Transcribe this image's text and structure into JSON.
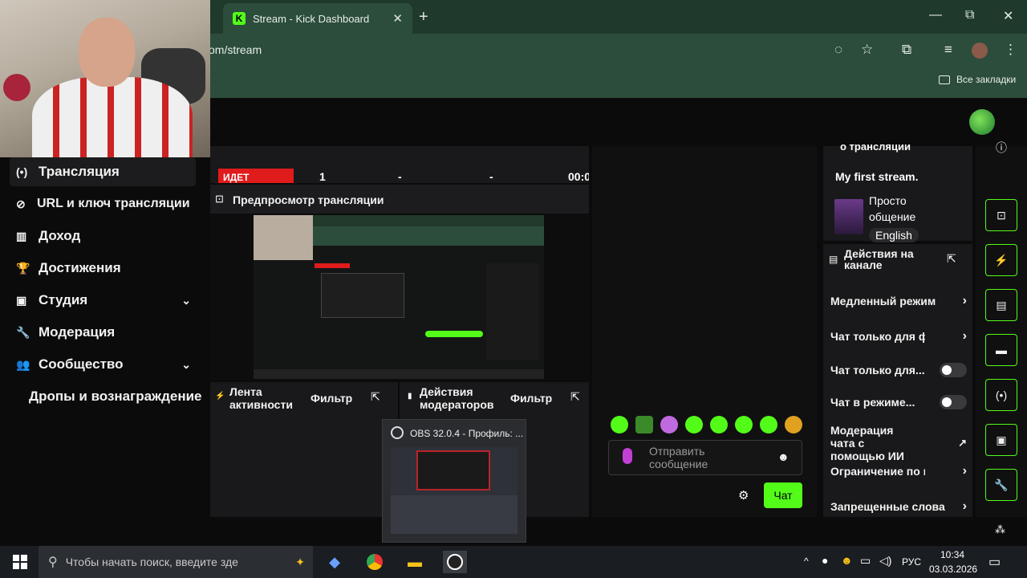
{
  "browser": {
    "tab_title": "Stream - Kick Dashboard",
    "tab_close": "✕",
    "new_tab": "+",
    "url": "om/stream",
    "bookmarks_label": "Все закладки",
    "window_controls": {
      "minimize": "—",
      "restore": "⧉",
      "close": "✕"
    }
  },
  "sidebar": {
    "items": [
      {
        "label": "Трансляция",
        "icon": "broadcast-icon",
        "glyph": "(•)"
      },
      {
        "label": "URL и ключ трансляции",
        "icon": "link-icon",
        "glyph": "⊘"
      },
      {
        "label": "Доход",
        "icon": "chart-icon",
        "glyph": "▥"
      },
      {
        "label": "Достижения",
        "icon": "trophy-icon",
        "glyph": "🏆"
      },
      {
        "label": "Студия",
        "icon": "video-icon",
        "glyph": "▣"
      },
      {
        "label": "Модерация",
        "icon": "wrench-icon",
        "glyph": "🔧"
      },
      {
        "label": "Сообщество",
        "icon": "people-icon",
        "glyph": "👥"
      },
      {
        "label": "Дропы и вознаграждение"
      }
    ],
    "chevron": "⌄"
  },
  "top_panel": {
    "badge": "ИДЕТ",
    "c1": "1",
    "c2": "-",
    "c3": "-",
    "c4": "00:0"
  },
  "preview": {
    "title": "Предпросмотр трансляции"
  },
  "activity": {
    "title": "Лента активности",
    "filter": "Фильтр"
  },
  "mod_actions": {
    "title": "Действия модераторов",
    "filter": "Фильтр"
  },
  "chat": {
    "placeholder": "Отправить сообщение",
    "send_label": "Чат"
  },
  "stream_info": {
    "heading": "о трансляции",
    "title": "My first stream.",
    "category": "Просто общение",
    "language": "English"
  },
  "channel_actions": {
    "title": "Действия на канале",
    "items": [
      {
        "label": "Медленный режим",
        "kind": "arrow"
      },
      {
        "label": "Чат только для фолл",
        "kind": "arrow"
      },
      {
        "label": "Чат только для...",
        "kind": "toggle"
      },
      {
        "label": "Чат в режиме...",
        "kind": "toggle"
      },
      {
        "label": "Модерация чата с помощью ИИ",
        "kind": "external"
      },
      {
        "label": "Ограничение по возр",
        "kind": "arrow"
      },
      {
        "label": "Запрещенные слова",
        "kind": "arrow"
      }
    ]
  },
  "obs_thumb": {
    "title": "OBS 32.0.4 - Профиль: ..."
  },
  "taskbar": {
    "search_placeholder": "Чтобы начать поиск, введите зде",
    "lang": "РУС",
    "time": "10:34",
    "date": "03.03.2026"
  },
  "colors": {
    "accent": "#53fc18",
    "live": "#e01b1b",
    "browser": "#2c4d3b"
  }
}
